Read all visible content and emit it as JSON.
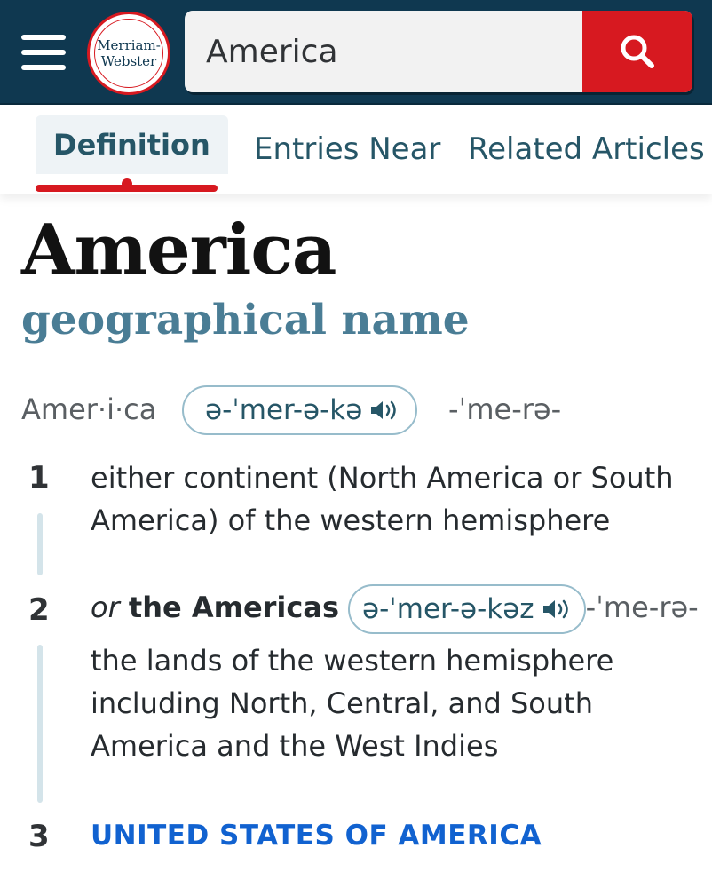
{
  "header": {
    "logo_line1": "Merriam-",
    "logo_line2": "Webster",
    "search_value": "America",
    "menu_icon": "hamburger-menu-icon",
    "search_icon": "magnifier-icon",
    "colors": {
      "header_bg": "#0f3850",
      "accent_red": "#d71920"
    }
  },
  "tabs": [
    {
      "label": "Definition",
      "active": true
    },
    {
      "label": "Entries Near",
      "active": false
    },
    {
      "label": "Related Articles",
      "active": false
    }
  ],
  "entry": {
    "headword": "America",
    "part_of_speech": "geographical name",
    "syllables": "Amer·i·ca",
    "pronunciation": "ə-ˈmer-ə-kə",
    "alt_pronunciation": "-ˈme-rə-",
    "senses": [
      {
        "number": "1",
        "text": "either continent (North America or South America) of the western hemisphere"
      },
      {
        "number": "2",
        "prefix": "or",
        "variant": "the Americas",
        "variant_pronunciation": "ə-ˈmer-ə-kəz",
        "variant_alt_pronunciation": "-ˈme-rə-",
        "text": "the lands of the western hemisphere including North, Central, and South America and the West Indies"
      },
      {
        "number": "3",
        "crossref": "UNITED STATES OF AMERICA"
      }
    ]
  }
}
